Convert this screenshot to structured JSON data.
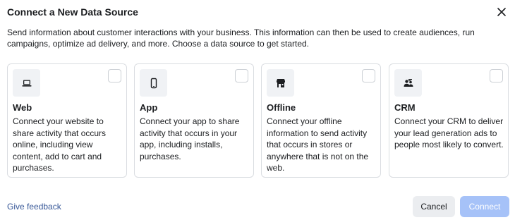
{
  "dialog": {
    "title": "Connect a New Data Source",
    "description": "Send information about customer interactions with your business. This information can then be used to create audiences, run campaigns, optimize ad delivery, and more. Choose a data source to get started."
  },
  "sources": [
    {
      "name": "Web",
      "icon": "laptop-icon",
      "description": "Connect your website to share activity that occurs online, including view content, add to cart and purchases."
    },
    {
      "name": "App",
      "icon": "phone-icon",
      "description": "Connect your app to share activity that occurs in your app, including installs, purchases."
    },
    {
      "name": "Offline",
      "icon": "store-icon",
      "description": "Connect your offline information to send activity that occurs in stores or anywhere that is not on the web."
    },
    {
      "name": "CRM",
      "icon": "people-icon",
      "description": "Connect your CRM to deliver your lead generation ads to people most likely to convert."
    }
  ],
  "footer": {
    "feedback_label": "Give feedback",
    "cancel_label": "Cancel",
    "connect_label": "Connect"
  },
  "colors": {
    "link": "#385898",
    "connect_disabled": "#a6c2f8",
    "cancel_bg": "#ebedf0",
    "card_border": "#dadde1",
    "icon_bg": "#f0f2f5"
  }
}
